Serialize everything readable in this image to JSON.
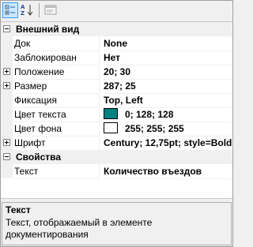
{
  "toolbar": {
    "categorized_icon": "categorized-icon",
    "alphabetical_icon": "alphabetical-sort-icon",
    "property_pages_icon": "property-pages-icon"
  },
  "categories": [
    {
      "label": "Внешний вид",
      "properties": [
        {
          "name": "Док",
          "value": "None",
          "expandable": false
        },
        {
          "name": "Заблокирован",
          "value": "Нет",
          "expandable": false
        },
        {
          "name": "Положение",
          "value": "20; 30",
          "expandable": true
        },
        {
          "name": "Размер",
          "value": "287; 25",
          "expandable": true
        },
        {
          "name": "Фиксация",
          "value": "Top, Left",
          "expandable": false
        },
        {
          "name": "Цвет текста",
          "value": "0; 128; 128",
          "swatch": "#008080",
          "expandable": false
        },
        {
          "name": "Цвет фона",
          "value": "255; 255; 255",
          "swatch": "#ffffff",
          "expandable": false
        },
        {
          "name": "Шрифт",
          "value": "Century; 12,75pt; style=Bold",
          "expandable": true
        }
      ]
    },
    {
      "label": "Свойства",
      "properties": [
        {
          "name": "Текст",
          "value": "Количество въездов",
          "expandable": false
        }
      ]
    }
  ],
  "help": {
    "title": "Текст",
    "description": "Текст, отображаемый в элементе документирования"
  },
  "colors": {
    "accent_toolbar_active": "#cce8ff",
    "gutter": "#f0f0f0"
  }
}
